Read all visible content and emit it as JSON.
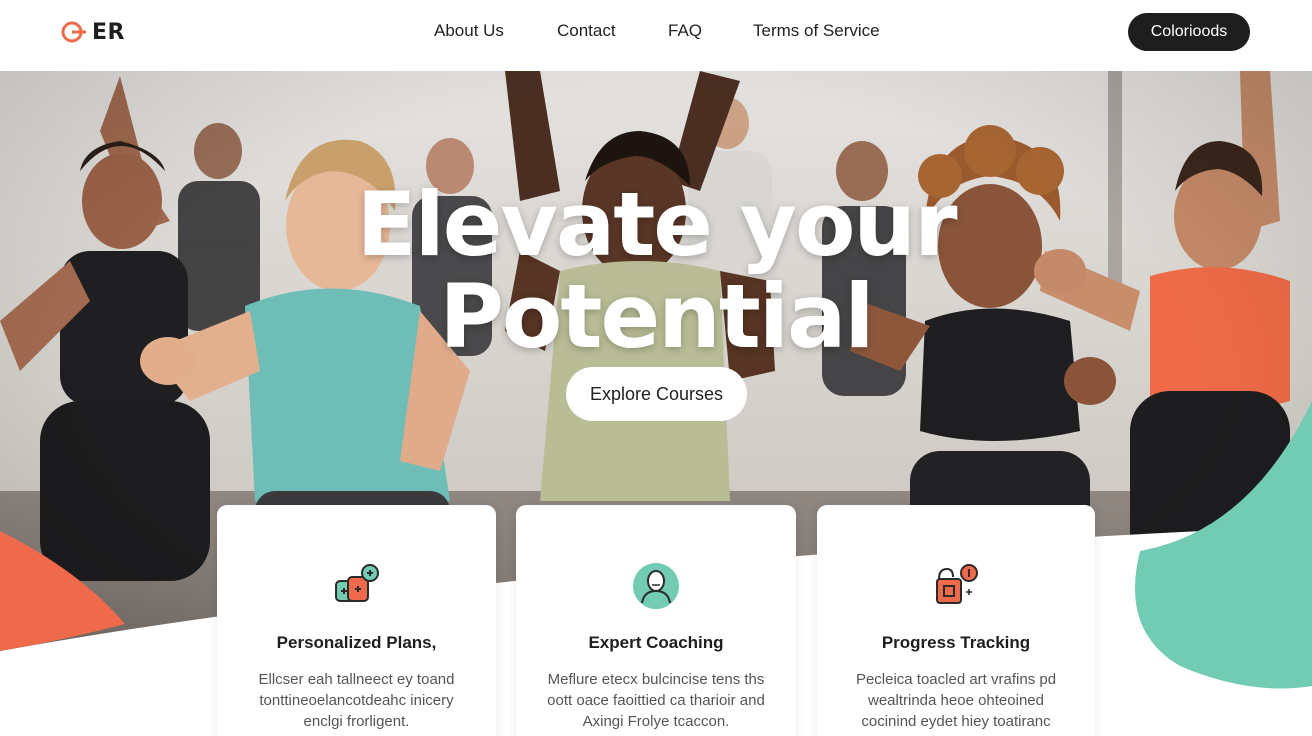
{
  "brand": {
    "logo_text": "ER",
    "accent": "#ef6a4b",
    "dark": "#1e1e1e",
    "teal": "#72cbb3"
  },
  "nav": {
    "links": [
      "About Us",
      "Contact",
      "FAQ",
      "Terms of Service"
    ],
    "cta_label": "Colorioods"
  },
  "hero": {
    "title_line1": "Elevate your",
    "title_line2": "Potential",
    "button_label": "Explore Courses"
  },
  "features": [
    {
      "icon": "plans-icon",
      "title": "Personalized Plans,",
      "desc": "Ellcser eah tallneect ey toand tonttineoelancotdeahc inicery enclgi frorligent."
    },
    {
      "icon": "coach-icon",
      "title": "Expert Coaching",
      "desc": "Meflure etecx bulcincise tens ths oott oace faoittied ca tharioir and Axingi Frolye tcaccon."
    },
    {
      "icon": "tracking-icon",
      "title": "Progress Tracking",
      "desc": "Pecleica toacled art vrafins pd wealtrinda heoe ohteoined cocinind eydet hiey toatiranc"
    }
  ]
}
